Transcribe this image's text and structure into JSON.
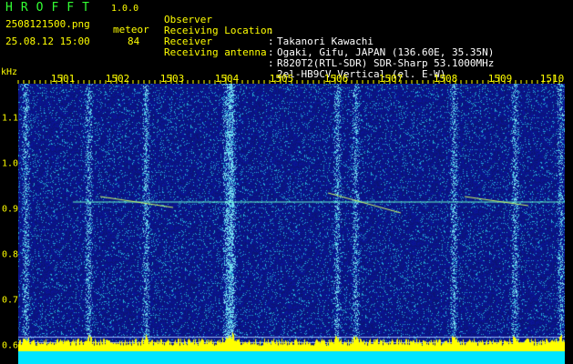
{
  "header": {
    "app_title": "HROFFT",
    "version": "1.0.0",
    "filename": "2508121500.png",
    "datetime": "25.08.12 15:00",
    "meteor_label": "meteor",
    "meteor_count": "84"
  },
  "info": [
    {
      "key": "Observer",
      "sep": ":",
      "value": "Takanori Kawachi"
    },
    {
      "key": "Receiving Location",
      "sep": ":",
      "value": "Ogaki, Gifu, JAPAN (136.60E, 35.35N)"
    },
    {
      "key": "Receiver",
      "sep": ":",
      "value": "R820T2(RTL-SDR) SDR-Sharp 53.1000MHz"
    },
    {
      "key": "Receiving antenna",
      "sep": ":",
      "value": "2el-HB9CV Vertical (el. E-W)"
    }
  ],
  "axis": {
    "y_unit": "kHz",
    "x_ticks": [
      "1501",
      "1502",
      "1503",
      "1504",
      "1505",
      "1506",
      "1507",
      "1508",
      "1509",
      "1510"
    ],
    "y_ticks": [
      "1.1",
      "1.0",
      "0.9",
      "0.8",
      "0.7",
      "0.6"
    ]
  },
  "colors": {
    "background": "#000000",
    "label_yellow": "#ffff00",
    "title_green": "#33ff33",
    "spectrum_blue": "#1a2fb0",
    "baseline_cyan": "#00e5ff"
  }
}
